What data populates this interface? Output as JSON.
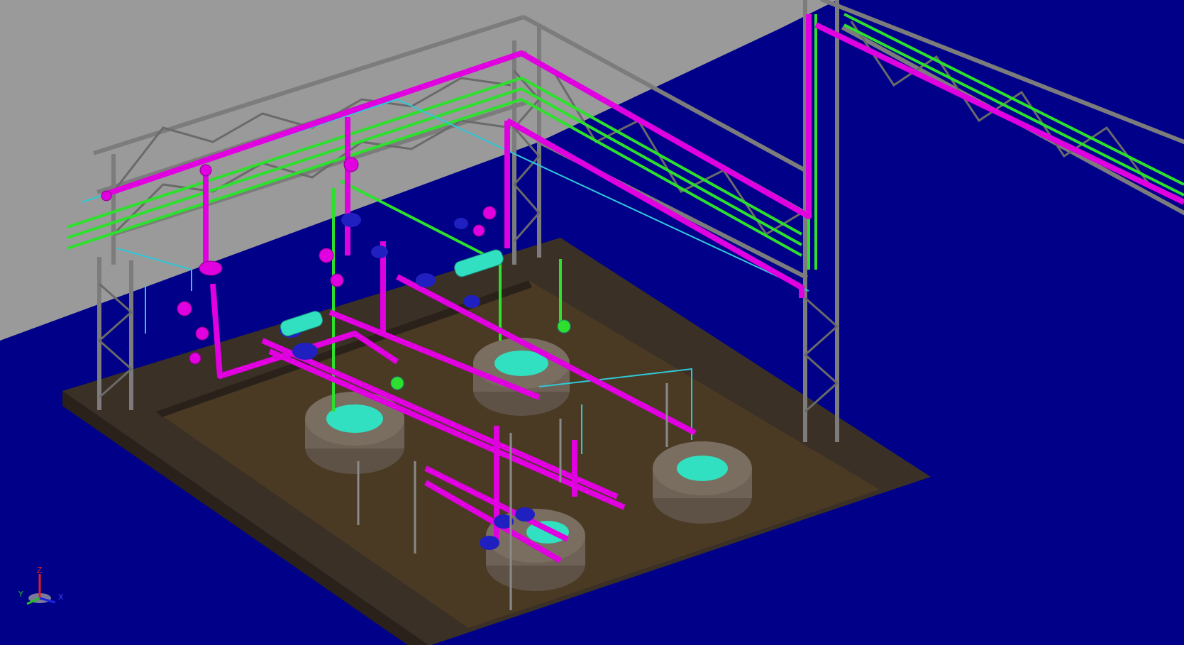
{
  "viewport": {
    "background": "#000088",
    "wall_color": "#9a9a9a",
    "floor_color": "#4a3a24",
    "curb_color": "#3a3026"
  },
  "colors": {
    "steel": "#7c7c7c",
    "steel_dark": "#4a4a4a",
    "pipe_magenta": "#e000e0",
    "pipe_magenta_dark": "#8a008a",
    "pipe_green": "#2ee02e",
    "pipe_cyan": "#30c8d8",
    "pipe_blue": "#1010c8",
    "tank_wall": "#6e6256",
    "tank_top": "#30e0c0",
    "valve": "#2020c0"
  },
  "triad": {
    "z_label": "Z",
    "y_label": "Y",
    "x_label": "X",
    "z_color": "#e02020",
    "y_color": "#20c020",
    "x_color": "#2020e0"
  }
}
